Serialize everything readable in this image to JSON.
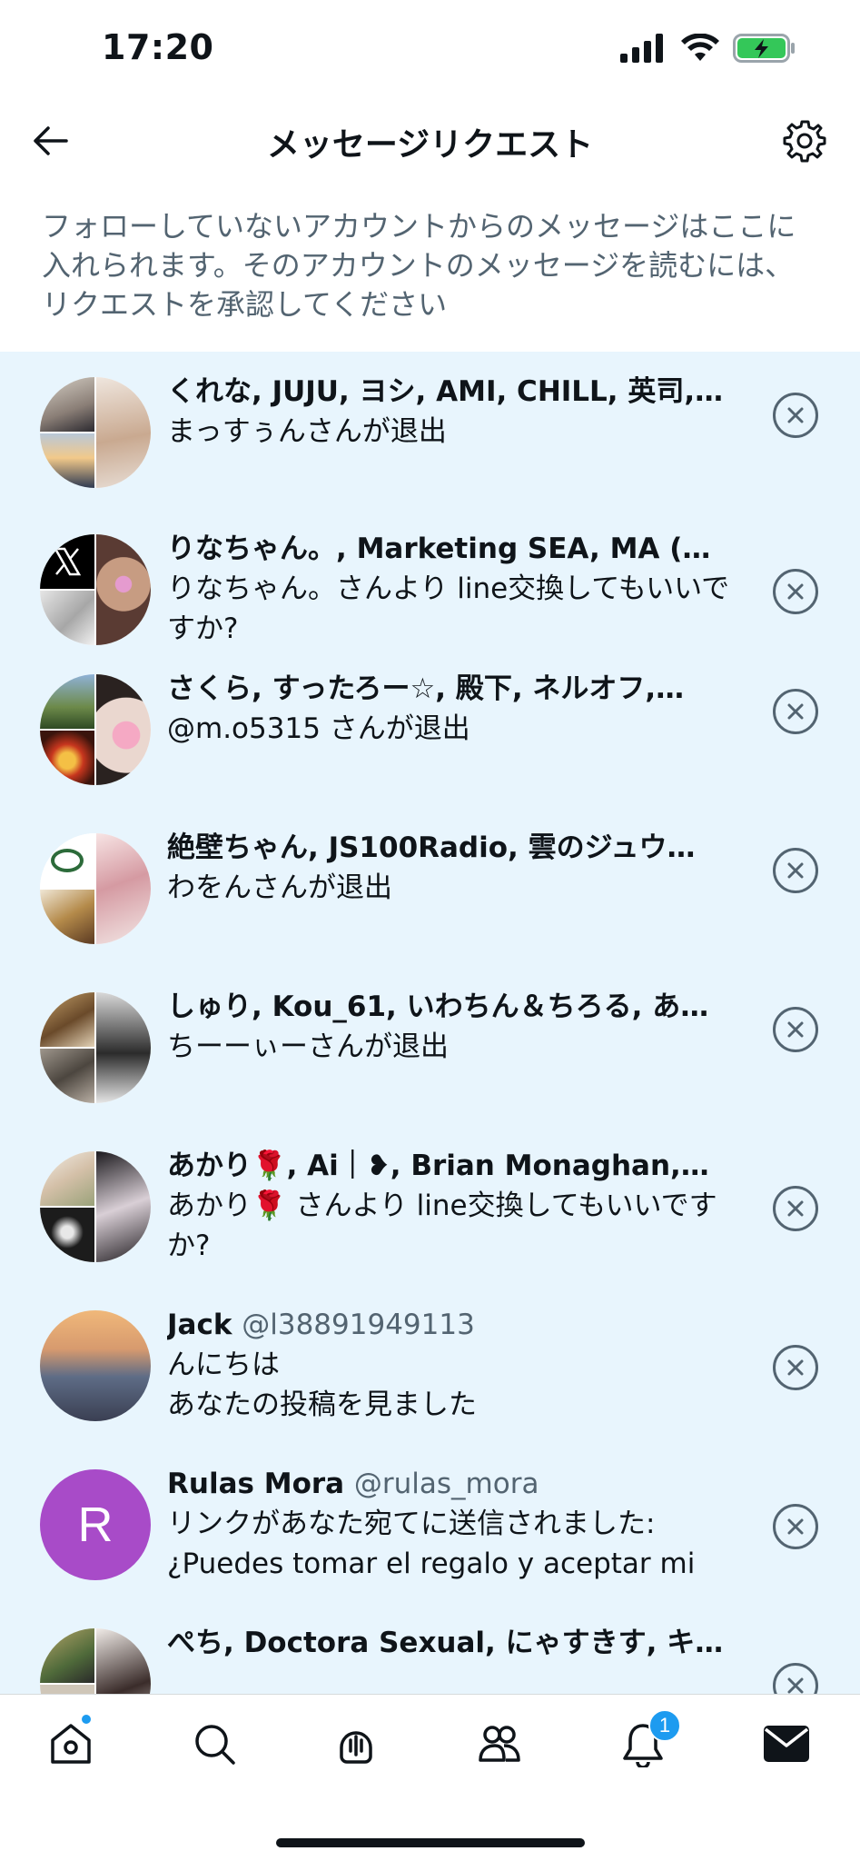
{
  "status_bar": {
    "time": "17:20"
  },
  "header": {
    "title": "メッセージリクエスト"
  },
  "description": "フォローしていないアカウントからのメッセージはここに入れられます。そのアカウントのメッセージを読むには、リクエストを承認してください",
  "requests": [
    {
      "title": "くれな, JUJU, ヨシ, AMI, CHILL, 英司,…",
      "message": "まっすぅんさんが退出"
    },
    {
      "title": "りなちゃん。, Marketing SEA, MA (…",
      "message": "りなちゃん。さんより line交換してもいいですか?"
    },
    {
      "title": "さくら, すったろー☆, 殿下, ネルオフ,…",
      "message": "@m.o5315 さんが退出"
    },
    {
      "title": "絶壁ちゃん, JS100Radio, 雲のジュウ…",
      "message": "わをんさんが退出"
    },
    {
      "title": "しゅり, Kou_61, いわちん＆ちろる, あ…",
      "message": "ちーーぃーさんが退出"
    },
    {
      "title": "あかり🌹, Ai｜❥, Brian Monaghan,…",
      "message": "あかり🌹 さんより line交換してもいいですか?"
    },
    {
      "title": "Jack",
      "handle": "@l38891949113",
      "message_line1": "んにちは",
      "message_line2": "あなたの投稿を見ました"
    },
    {
      "title": "Rulas Mora",
      "handle": "@rulas_mora",
      "avatar_letter": "R",
      "message_line1": "リンクがあなた宛てに送信されました:",
      "message_line2": "¿Puedes tomar el regalo y aceptar mi"
    },
    {
      "title": "ぺち, Doctora Sexual, にゃすきす, キ…"
    }
  ],
  "tabbar": {
    "notifications_badge": "1"
  },
  "colors": {
    "accent": "#1d9bf0",
    "list_bg": "#e8f5fd",
    "secondary_text": "#536471",
    "avatar_r": "#a84bc8"
  }
}
